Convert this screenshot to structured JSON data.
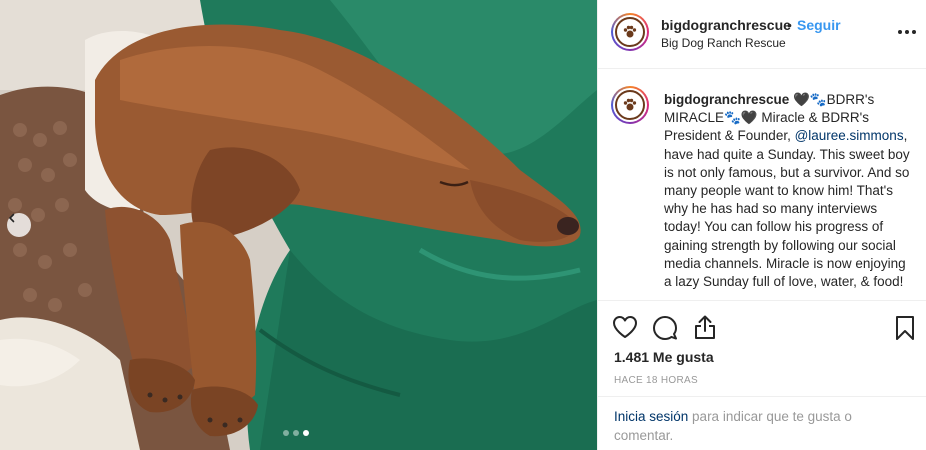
{
  "post": {
    "username": "bigdogranchrescue",
    "bullet": "•",
    "follow_label": "Seguir",
    "location": "Big Dog Ranch Rescue",
    "avatar_icon": "paw-logo-icon",
    "carousel": {
      "total_images": 3,
      "active_index": 2
    }
  },
  "caption": {
    "username": "bigdogranchrescue",
    "text_1": " 🖤🐾BDRR's MIRACLE🐾🖤 Miracle & BDRR's President & Founder, ",
    "mention": "@lauree.simmons",
    "text_2": ", have had quite a Sunday. This sweet boy is not only famous, but a survivor. And so many people want to know him! That's why he has had so many interviews today! You can follow his progress of gaining strength by following our social media channels. Miracle is now enjoying a lazy Sunday full of love, water, & food!"
  },
  "actions": {
    "icons": [
      "heart-icon",
      "comment-icon",
      "share-icon",
      "bookmark-icon"
    ],
    "likes": "1.481 Me gusta",
    "time_ago": "HACE 18 HORAS"
  },
  "login": {
    "link": "Inicia sesión",
    "text": " para indicar que te gusta o comentar."
  },
  "colors": {
    "link_blue": "#3897f0",
    "dark_link": "#003569",
    "muted": "#999999",
    "blanket_green": "#1e7a5c",
    "dog_brown": "#9a5a32"
  }
}
